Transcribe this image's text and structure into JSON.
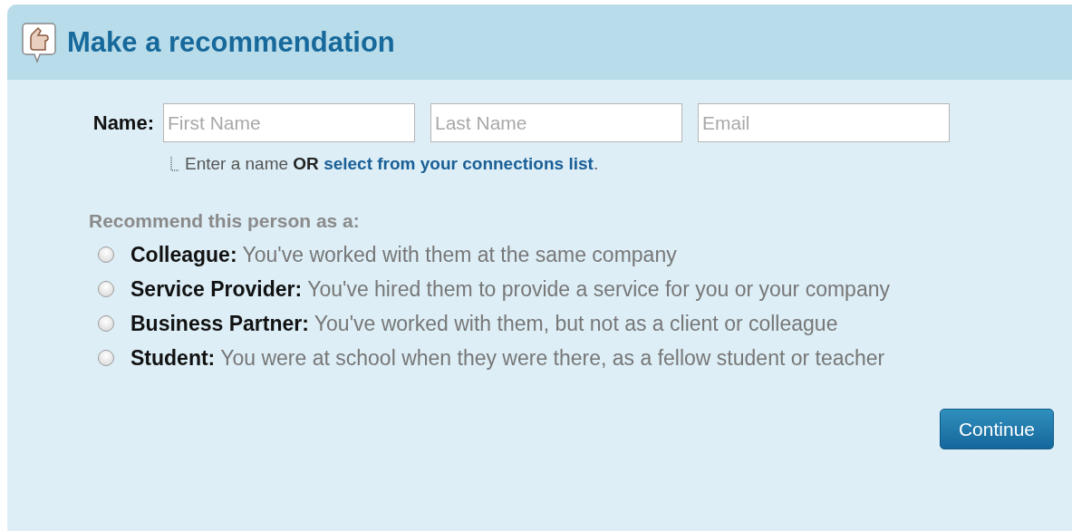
{
  "title": "Make a recommendation",
  "name_field": {
    "label": "Name:",
    "inputs": [
      {
        "placeholder": "First Name"
      },
      {
        "placeholder": "Last Name"
      },
      {
        "placeholder": "Email"
      }
    ]
  },
  "hint": {
    "text": "Enter a name **OR** ",
    "link": "select from your connections list",
    "suffix": "."
  },
  "question": "Recommend this person as a:",
  "options": [
    {
      "label": "Colleague:",
      "description": "You've worked with them at the same company",
      "selected": false
    },
    {
      "label": "Service Provider:",
      "description": "You've hired them to provide a service for you or your company",
      "selected": false
    },
    {
      "label": "Business Partner:",
      "description": "You've worked with them, but not as a client or colleague",
      "selected": false
    },
    {
      "label": "Student:",
      "description": "You were at school when they were there, as a fellow student or teacher",
      "selected": false
    }
  ],
  "button": "Continue"
}
